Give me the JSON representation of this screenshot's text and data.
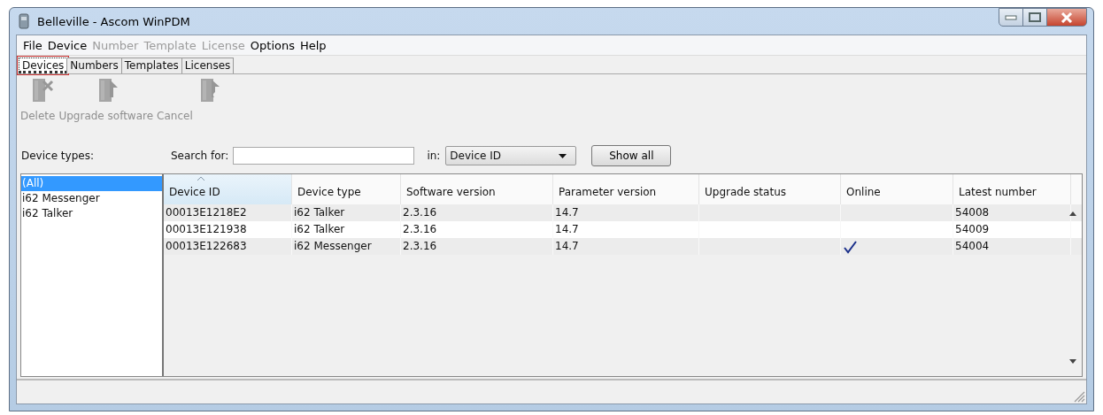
{
  "window": {
    "title": "Belleville - Ascom WinPDM"
  },
  "menu": [
    {
      "label": "File",
      "disabled": false
    },
    {
      "label": "Device",
      "disabled": false
    },
    {
      "label": "Number",
      "disabled": true
    },
    {
      "label": "Template",
      "disabled": true
    },
    {
      "label": "License",
      "disabled": true
    },
    {
      "label": "Options",
      "disabled": false
    },
    {
      "label": "Help",
      "disabled": false
    }
  ],
  "tabs": [
    {
      "label": "Devices",
      "selected": true
    },
    {
      "label": "Numbers",
      "selected": false
    },
    {
      "label": "Templates",
      "selected": false
    },
    {
      "label": "Licenses",
      "selected": false
    }
  ],
  "toolbar": [
    {
      "label": "Delete",
      "kind": "delete",
      "disabled": true
    },
    {
      "label": "Upgrade software",
      "kind": "upgrade",
      "disabled": true
    },
    {
      "label": "Cancel",
      "kind": "cancel",
      "disabled": true
    }
  ],
  "filter": {
    "device_types_label": "Device types:",
    "search_label": "Search for:",
    "in_label": "in:",
    "in_value": "Device ID",
    "show_all": "Show all"
  },
  "device_types": [
    {
      "label": "(All)",
      "selected": true
    },
    {
      "label": "i62 Messenger",
      "selected": false
    },
    {
      "label": "i62 Talker",
      "selected": false
    }
  ],
  "table": {
    "columns": [
      {
        "label": "Device ID",
        "sorted": true
      },
      {
        "label": "Device type",
        "sorted": false
      },
      {
        "label": "Software version",
        "sorted": false
      },
      {
        "label": "Parameter version",
        "sorted": false
      },
      {
        "label": "Upgrade status",
        "sorted": false
      },
      {
        "label": "Online",
        "sorted": false
      },
      {
        "label": "Latest number",
        "sorted": false
      }
    ],
    "rows": [
      {
        "device_id": "00013E1218E2",
        "device_type": "i62 Talker",
        "software_version": "2.3.16",
        "parameter_version": "14.7",
        "online": false,
        "latest_number": "54008"
      },
      {
        "device_id": "00013E121938",
        "device_type": "i62 Talker",
        "software_version": "2.3.16",
        "parameter_version": "14.7",
        "online": false,
        "latest_number": "54009"
      },
      {
        "device_id": "00013E122683",
        "device_type": "i62 Messenger",
        "software_version": "2.3.16",
        "parameter_version": "14.7",
        "online": true,
        "latest_number": "54004"
      }
    ]
  }
}
